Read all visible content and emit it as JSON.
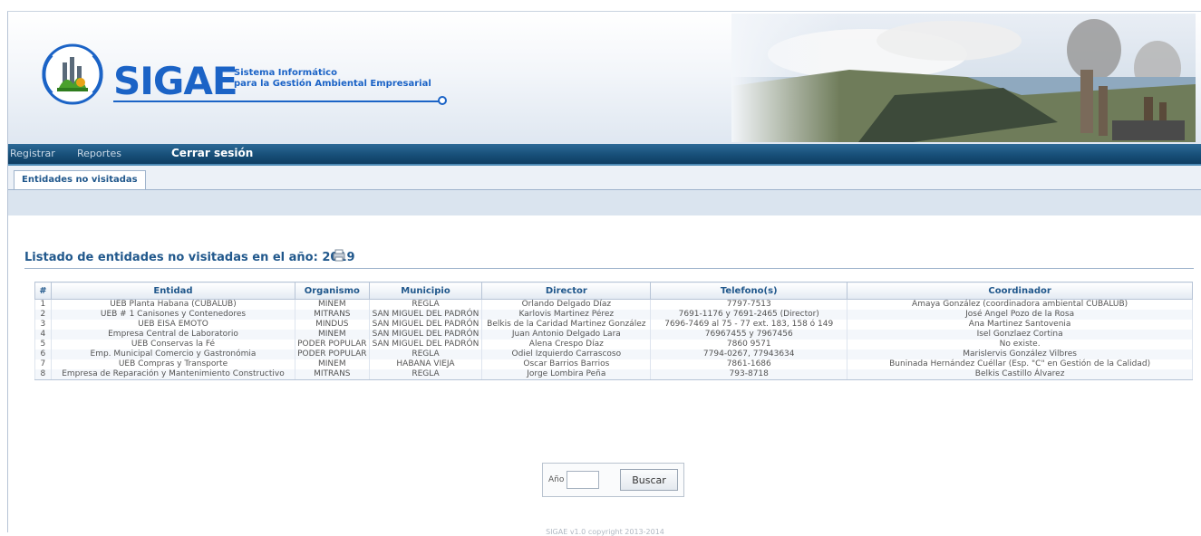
{
  "app": {
    "logo_text": "SIGAE",
    "logo_subtitle_line1": "Sistema Informático",
    "logo_subtitle_line2": "para la Gestión Ambiental Empresarial",
    "brand_color": "#1b63c6"
  },
  "nav": {
    "items": [
      "Registrar",
      "Reportes",
      "Cerrar sesión"
    ]
  },
  "tabs": [
    {
      "label": "Entidades no visitadas",
      "active": true
    }
  ],
  "main": {
    "title": "Listado de entidades no visitadas en el año: 2019",
    "print_icon": "printer-icon"
  },
  "table": {
    "headers": [
      "#",
      "Entidad",
      "Organismo",
      "Municipio",
      "Director",
      "Telefono(s)",
      "Coordinador"
    ],
    "rows": [
      [
        "1",
        "UEB Planta Habana (CUBALUB)",
        "MINEM",
        "REGLA",
        "Orlando Delgado Díaz",
        "7797-7513",
        "Amaya González (coordinadora ambiental CUBALUB)"
      ],
      [
        "2",
        "UEB # 1 Canisones y Contenedores",
        "MITRANS",
        "SAN MIGUEL DEL PADRÓN",
        "Karlovis Martinez Pérez",
        "7691-1176 y 7691-2465 (Director)",
        "José Angel Pozo de la Rosa"
      ],
      [
        "3",
        "UEB EISA EMOTO",
        "MINDUS",
        "SAN MIGUEL DEL PADRÓN",
        "Belkis de la Caridad Martinez González",
        "7696-7469 al 75 - 77 ext. 183, 158 ó 149",
        "Ana Martinez Santovenia"
      ],
      [
        "4",
        "Empresa Central de Laboratorio",
        "MINEM",
        "SAN MIGUEL DEL PADRÓN",
        "Juan Antonio Delgado Lara",
        "76967455 y 7967456",
        "Isel Gonzlaez Cortina"
      ],
      [
        "5",
        "UEB Conservas la Fé",
        "PODER POPULAR",
        "SAN MIGUEL DEL PADRÓN",
        "Alena Crespo Díaz",
        "7860 9571",
        "No existe."
      ],
      [
        "6",
        "Emp. Municipal Comercio y Gastronómia",
        "PODER POPULAR",
        "REGLA",
        "Odiel Izquierdo Carrascoso",
        "7794-0267, 77943634",
        "Marislervis González Vilbres"
      ],
      [
        "7",
        "UEB Compras y Transporte",
        "MINEM",
        "HABANA VIEJA",
        "Oscar Barrios Barrios",
        "7861-1686",
        "Buninada Hernández Cuéllar (Esp. \"C\" en Gestión de la Calidad)"
      ],
      [
        "8",
        "Empresa de Reparación y Mantenimiento Constructivo",
        "MITRANS",
        "REGLA",
        "Jorge Lombira Peña",
        "793-8718",
        "Belkis Castillo Álvarez"
      ]
    ]
  },
  "search": {
    "label": "Año",
    "value": "",
    "placeholder": "",
    "button_label": "Buscar"
  },
  "footer": {
    "text": "SIGAE v1.0 copyright 2013-2014"
  }
}
